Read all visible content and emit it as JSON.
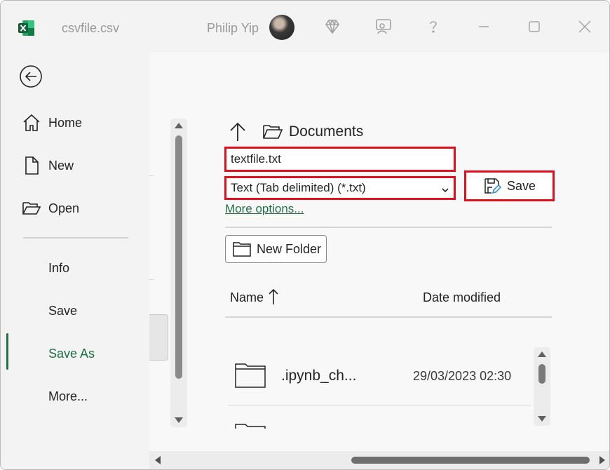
{
  "titlebar": {
    "document_title": "csvfile.csv",
    "user_name": "Philip Yip",
    "icons": [
      "excel-icon",
      "diamond-icon",
      "coauthor-icon",
      "help-icon",
      "minimize-icon",
      "maximize-icon",
      "close-icon"
    ]
  },
  "nav": {
    "back_icon": "back-arrow-icon",
    "items": [
      {
        "label": "Home",
        "icon": "home-icon"
      },
      {
        "label": "New",
        "icon": "new-document-icon"
      },
      {
        "label": "Open",
        "icon": "open-folder-icon"
      },
      {
        "label": "Info"
      },
      {
        "label": "Save"
      },
      {
        "label": "Save As",
        "active": true
      },
      {
        "label": "More..."
      }
    ],
    "accent_color": "#1e7145"
  },
  "save_panel": {
    "location": "Documents",
    "filename": "textfile.txt",
    "filetype": "Text (Tab delimited) (*.txt)",
    "save_label": "Save",
    "more_options_label": "More options...",
    "new_folder_label": "New Folder",
    "highlight_color": "#e0101c",
    "columns": {
      "name": "Name",
      "date_modified": "Date modified"
    },
    "files": [
      {
        "name": ".ipynb_ch...",
        "date_modified": "29/03/2023 02:30",
        "icon": "folder-icon"
      }
    ]
  }
}
